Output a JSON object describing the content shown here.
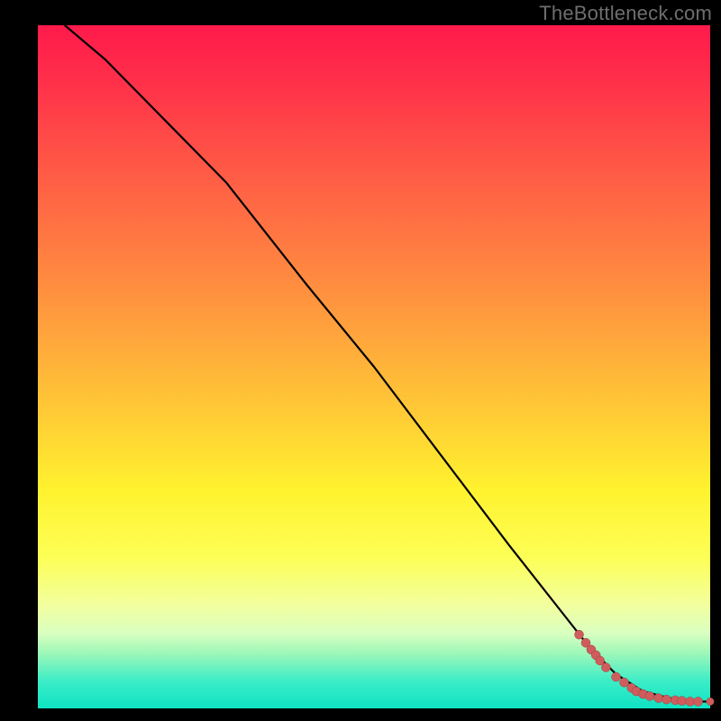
{
  "watermark": "TheBottleneck.com",
  "colors": {
    "background": "#000000",
    "watermark": "#6e6e6e",
    "line": "#000000",
    "point_fill": "#cf5d5d",
    "point_stroke": "#a23f3f"
  },
  "chart_data": {
    "type": "line",
    "title": "",
    "xlabel": "",
    "ylabel": "",
    "xlim": [
      0,
      100
    ],
    "ylim": [
      0,
      100
    ],
    "series": [
      {
        "name": "curve",
        "x": [
          4,
          10,
          20,
          28,
          40,
          50,
          60,
          70,
          78,
          82,
          86,
          90,
          94,
          97,
          100
        ],
        "y": [
          100,
          95,
          85,
          77,
          62,
          50,
          37,
          24,
          14,
          9,
          5,
          2.5,
          1.5,
          1,
          1
        ]
      }
    ],
    "points": {
      "name": "data-points",
      "x": [
        80.5,
        81.5,
        82.3,
        83.0,
        83.6,
        84.5,
        86.0,
        87.2,
        88.3,
        89.0,
        90.0,
        91.0,
        92.3,
        93.5,
        94.8,
        95.8,
        97.0,
        98.2,
        100.0
      ],
      "y": [
        10.8,
        9.6,
        8.6,
        7.8,
        7.0,
        6.0,
        4.6,
        3.8,
        3.0,
        2.5,
        2.1,
        1.8,
        1.5,
        1.3,
        1.2,
        1.1,
        1.0,
        1.0,
        1.0
      ]
    },
    "grid": false,
    "legend": false
  }
}
